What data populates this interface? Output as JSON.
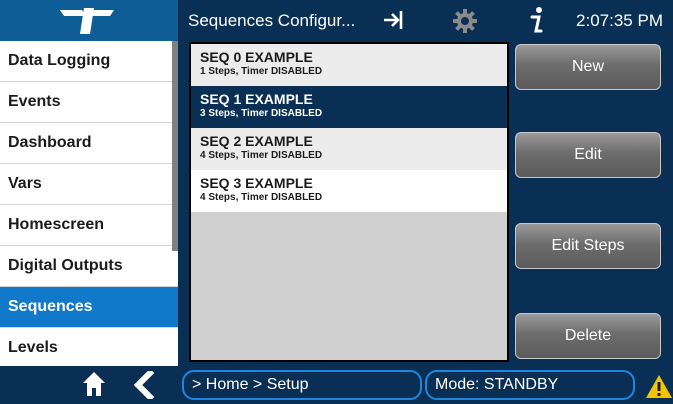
{
  "header": {
    "logo_icon": "teledyne-logo-icon",
    "title": "Sequences Configur...",
    "login_icon": "login-arrow-icon",
    "settings_icon": "gear-icon",
    "info_icon": "info-icon",
    "time": "2:07:35 PM"
  },
  "sidebar": {
    "items": [
      {
        "label": "Data Logging"
      },
      {
        "label": "Events"
      },
      {
        "label": "Dashboard"
      },
      {
        "label": "Vars"
      },
      {
        "label": "Homescreen"
      },
      {
        "label": "Digital Outputs"
      },
      {
        "label": "Sequences",
        "active": true
      },
      {
        "label": "Levels"
      }
    ]
  },
  "sequences": [
    {
      "title": "SEQ 0 EXAMPLE",
      "subtitle": "1 Steps, Timer DISABLED"
    },
    {
      "title": "SEQ 1 EXAMPLE",
      "subtitle": "3 Steps, Timer DISABLED",
      "selected": true
    },
    {
      "title": "SEQ 2 EXAMPLE",
      "subtitle": "4 Steps, Timer DISABLED"
    },
    {
      "title": "SEQ 3 EXAMPLE",
      "subtitle": "4 Steps, Timer DISABLED"
    }
  ],
  "buttons": {
    "new": "New",
    "edit": "Edit",
    "edit_steps": "Edit Steps",
    "delete": "Delete"
  },
  "footer": {
    "home_icon": "home-icon",
    "back_icon": "back-chevron-icon",
    "breadcrumb": "> Home > Setup",
    "mode": "Mode: STANDBY",
    "warning_icon": "warning-icon"
  },
  "colors": {
    "accent": "#1179c9",
    "header_bg": "#0a2f54",
    "selected_bg": "#0a2f54",
    "warning": "#f5c400"
  }
}
